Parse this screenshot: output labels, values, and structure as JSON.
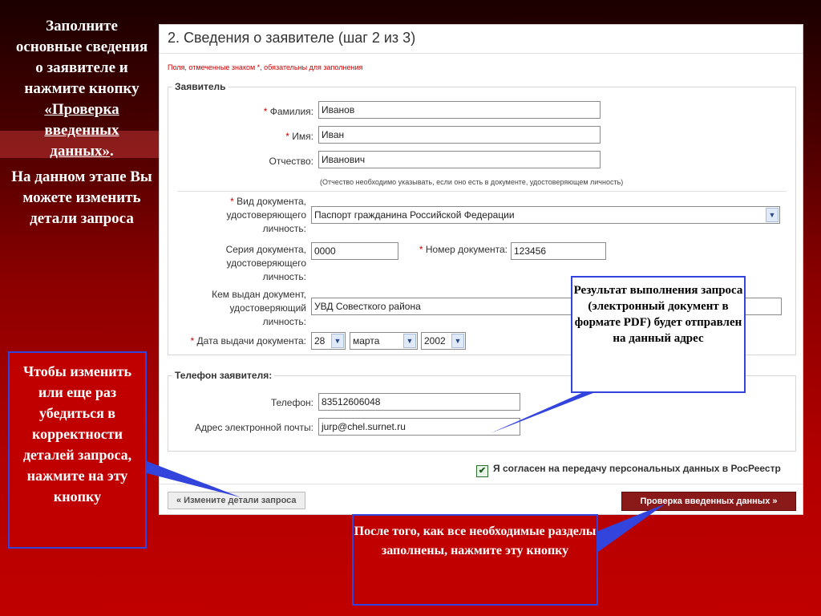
{
  "instruction": {
    "p1": "Заполните основные сведения о заявителе и нажмите кнопку ",
    "p1_link": "«Проверка введенных данных»",
    "p1_end": ".",
    "p2": "На данном этапе Вы можете изменить детали запроса"
  },
  "form": {
    "title": "2. Сведения о заявителе (шаг 2 из 3)",
    "required_note": "Поля, отмеченные знаком *, обязательны для заполнения",
    "applicant_legend": "Заявитель",
    "surname_label": "Фамилия:",
    "surname_value": "Иванов",
    "name_label": "Имя:",
    "name_value": "Иван",
    "patronymic_label": "Отчество:",
    "patronymic_value": "Иванович",
    "patronymic_hint": "(Отчество необходимо указывать, если оно есть в документе, удостоверяющем личность)",
    "doc_type_label": "Вид документа, удостоверяющего личность:",
    "doc_type_value": "Паспорт гражданина Российской Федерации",
    "doc_series_label": "Серия документа, удостоверяющего личность:",
    "doc_series_value": "0000",
    "doc_number_label": "Номер документа:",
    "doc_number_value": "123456",
    "issued_by_label": "Кем выдан документ, удостоверяющий личность:",
    "issued_by_value": "УВД Совесткого района",
    "issue_date_label": "Дата выдачи документа:",
    "issue_day": "28",
    "issue_month": "марта",
    "issue_year": "2002",
    "phone_legend": "Телефон заявителя:",
    "phone_label": "Телефон:",
    "phone_value": "83512606048",
    "email_label": "Адрес электронной почты:",
    "email_value": "jurp@chel.surnet.ru",
    "required_mark": "*",
    "consent_check": "✔",
    "consent_label": "Я согласен на передачу персональных данных в РосРеестр",
    "back_button": "« Измените детали запроса",
    "check_button": "Проверка введенных данных »"
  },
  "callouts": {
    "left": "Чтобы изменить или еще раз убедиться в корректности деталей запроса, нажмите на эту кнопку",
    "right": "Результат выполнения запроса (электронный документ в формате PDF) будет отправлен на данный адрес",
    "bottom": "После того, как все необходимые разделы заполнены, нажмите эту кнопку"
  },
  "icons": {
    "select_arrow": "chevron-down-icon",
    "checkbox": "check-icon"
  },
  "colors": {
    "callout_border": "#3344dd",
    "accent": "#c00000",
    "check_button": "#8a1a1a"
  }
}
